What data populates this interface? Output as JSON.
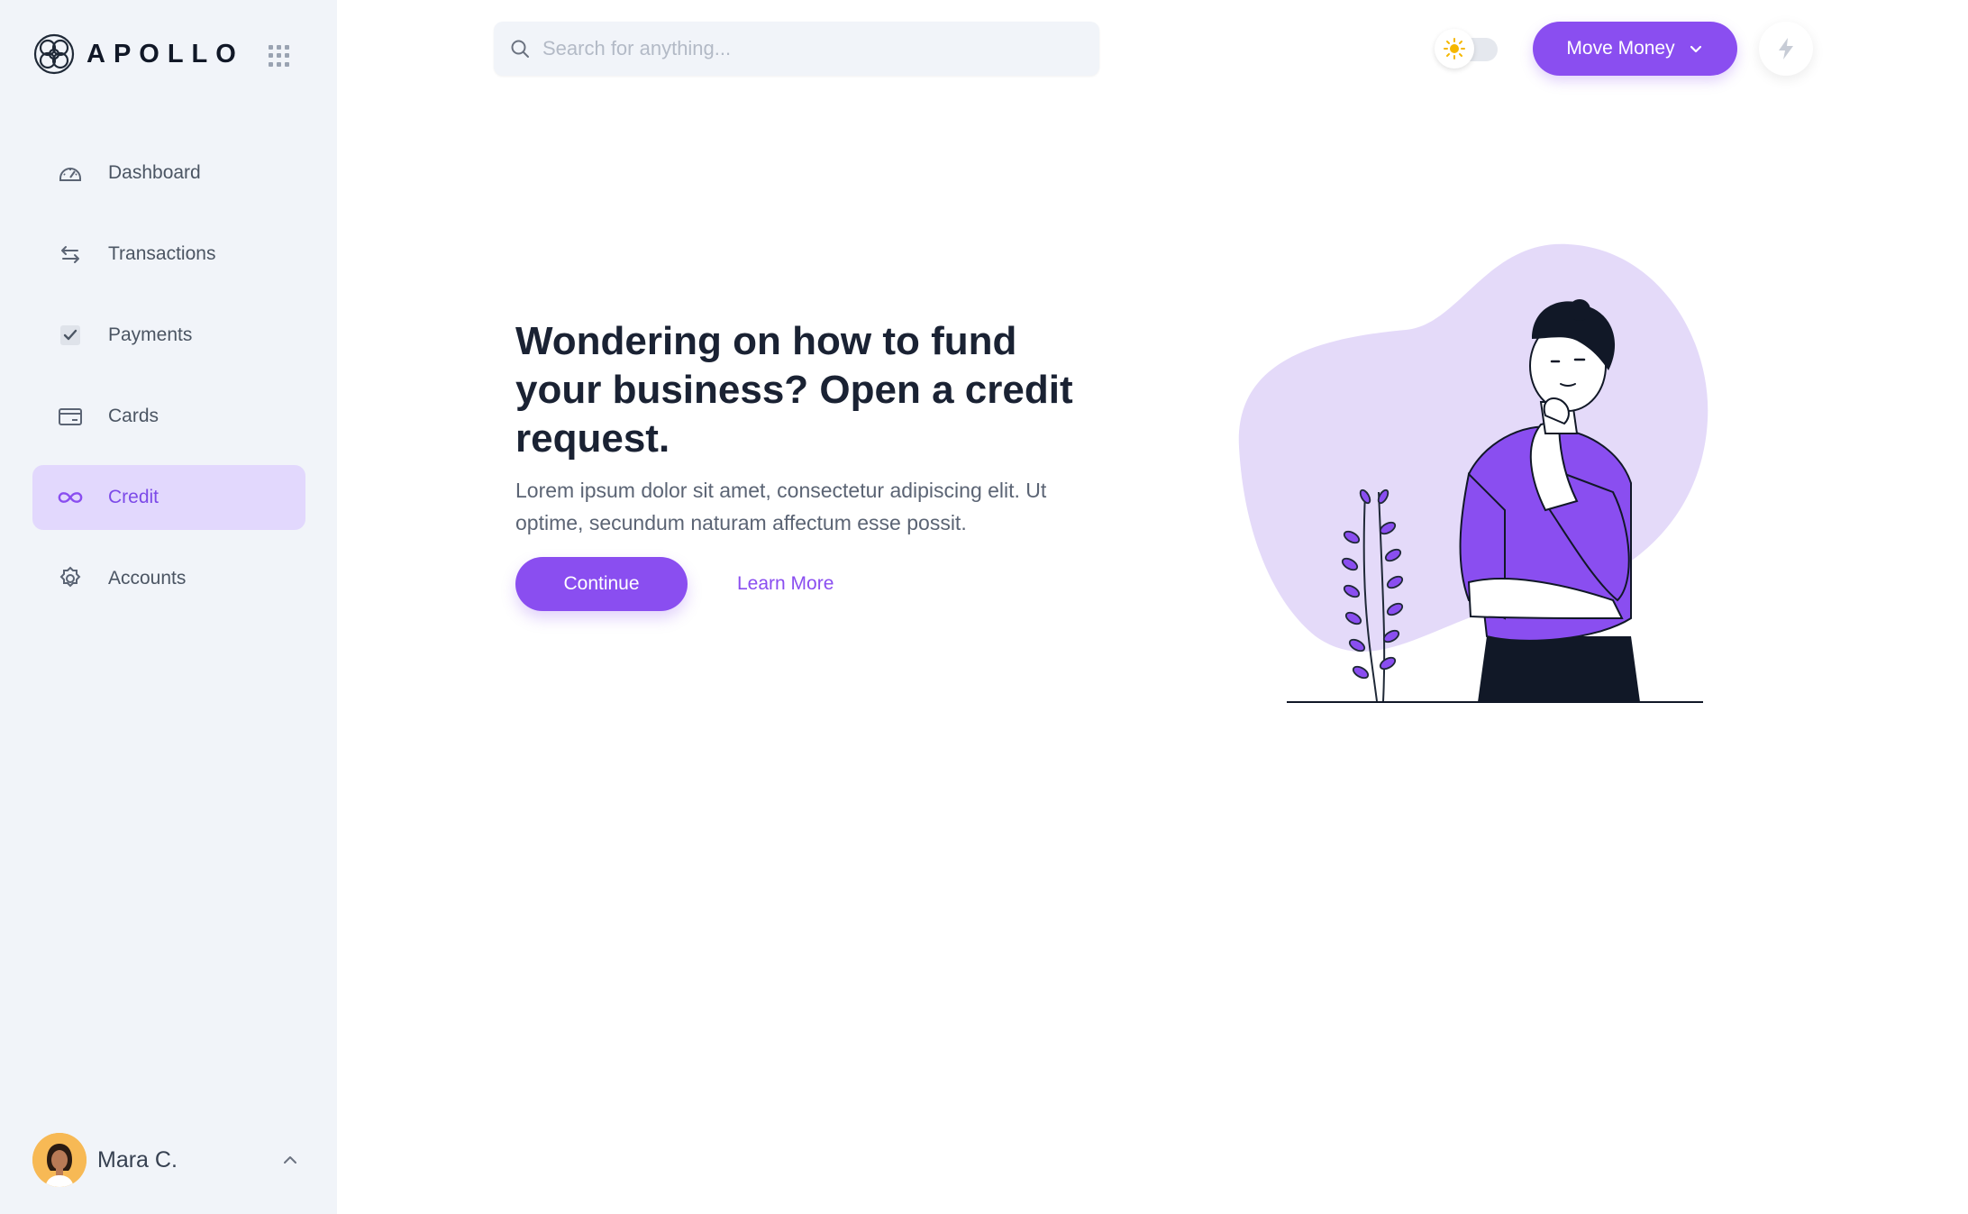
{
  "brand": {
    "name": "APOLLO"
  },
  "sidebar": {
    "items": [
      {
        "label": "Dashboard",
        "icon": "gauge-icon"
      },
      {
        "label": "Transactions",
        "icon": "swap-arrows-icon"
      },
      {
        "label": "Payments",
        "icon": "checkbox-icon"
      },
      {
        "label": "Cards",
        "icon": "credit-card-icon"
      },
      {
        "label": "Credit",
        "icon": "infinity-icon",
        "active": true
      },
      {
        "label": "Accounts",
        "icon": "gear-icon"
      }
    ],
    "user": {
      "name": "Mara C."
    }
  },
  "header": {
    "search_placeholder": "Search for anything...",
    "move_money_label": "Move Money"
  },
  "hero": {
    "title": "Wondering on how to fund your business? Open a credit request.",
    "description": "Lorem ipsum dolor sit amet, consectetur adipiscing elit. Ut optime, secundum naturam affectum esse possit.",
    "continue_label": "Continue",
    "learn_more_label": "Learn More"
  },
  "colors": {
    "accent": "#8a4ef0",
    "accent_light": "#e2d8fd",
    "sidebar_bg": "#f1f4f9",
    "text_dark": "#1a2233"
  }
}
